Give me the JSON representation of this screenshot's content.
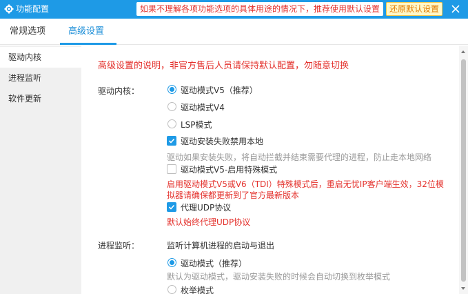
{
  "window": {
    "title": "功能配置",
    "notice": "如果不理解各项功能选项的具体用途的情况下，推荐使用默认设置",
    "restore_label": "还原默认设置"
  },
  "tabs": [
    {
      "label": "常规选项"
    },
    {
      "label": "高级设置"
    }
  ],
  "sidebar": {
    "items": [
      {
        "label": "驱动内核"
      },
      {
        "label": "进程监听"
      },
      {
        "label": "软件更新"
      }
    ]
  },
  "content": {
    "warning": "高级设置的说明，非官方售后人员请保持默认配置，勿随意切换",
    "driver": {
      "label": "驱动内核：",
      "radios": [
        {
          "label": "驱动模式V5（推荐）",
          "selected": true
        },
        {
          "label": "驱动模式V4",
          "selected": false
        },
        {
          "label": "LSP模式",
          "selected": false
        }
      ],
      "checks": [
        {
          "label": "驱动安装失败禁用本地",
          "checked": true,
          "desc": "驱动如果安装失败，将自动拦截并结束需要代理的进程，防止走本地网络"
        },
        {
          "label": "驱动模式V5-启用特殊模式",
          "checked": false,
          "desc_line1": "启用驱动模式V5或V6（TDI）特殊模式后，重启无忧IP客户端生效，32位模",
          "desc_line2": "拟器请确保都更新到了官方最新版本"
        },
        {
          "label": "代理UDP协议",
          "checked": true,
          "desc": "默认始终代理UDP协议"
        }
      ]
    },
    "process": {
      "label": "进程监听：",
      "desc": "监听计算机进程的启动与退出",
      "radios": [
        {
          "label": "驱动模式（推荐）",
          "selected": true,
          "desc": "默认为驱动模式，驱动安装失败的时候会自动切换到枚举模式"
        },
        {
          "label": "枚举模式",
          "selected": false
        }
      ]
    }
  },
  "colors": {
    "accent": "#1e9ae6",
    "warning": "#e4322d",
    "restore_text": "#e07b00"
  }
}
